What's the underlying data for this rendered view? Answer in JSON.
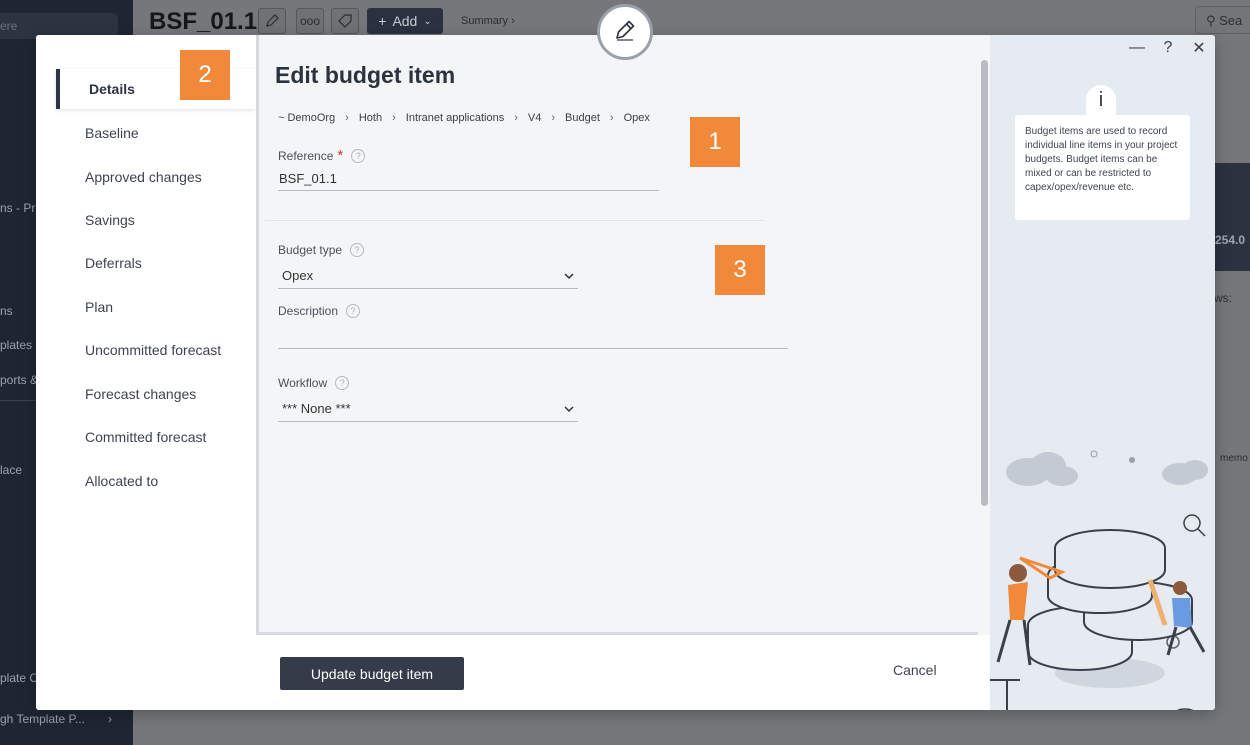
{
  "background": {
    "title": "BSF_01.1",
    "add_label": "Add",
    "summary_label": "Summary",
    "search_label": "Sea",
    "sidebar_search": "ere",
    "sidebar_items": [
      "ns - Pro",
      "ns",
      "plates",
      "ports &",
      "lace",
      "plate C",
      "gh Template P..."
    ],
    "value_label": "254.0",
    "rows_label": "ws:",
    "memo_label": "memo"
  },
  "modal": {
    "title": "Edit budget item",
    "breadcrumb": [
      "~ DemoOrg",
      "Hoth",
      "Intranet applications",
      "V4",
      "Budget",
      "Opex"
    ],
    "nav_items": [
      "Details",
      "Baseline",
      "Approved changes",
      "Savings",
      "Deferrals",
      "Plan",
      "Uncommitted forecast",
      "Forecast changes",
      "Committed forecast",
      "Allocated to"
    ],
    "fields": {
      "reference_label": "Reference",
      "reference_value": "BSF_01.1",
      "budget_type_label": "Budget type",
      "budget_type_value": "Opex",
      "description_label": "Description",
      "description_value": "",
      "workflow_label": "Workflow",
      "workflow_value": "*** None ***"
    },
    "buttons": {
      "update": "Update budget item",
      "cancel": "Cancel"
    },
    "info_text": "Budget items are used to record individual line items in your project budgets. Budget items can be mixed or can be restricted to capex/opex/revenue etc.",
    "info_icon_glyph": "i",
    "window_controls": {
      "minimize": "—",
      "help": "?",
      "close": "✕"
    }
  },
  "annotations": {
    "badge_1": "1",
    "badge_2": "2",
    "badge_3": "3"
  },
  "colors": {
    "accent_dark": "#343b49",
    "badge_orange": "#f0893a",
    "required_red": "#d9332c",
    "info_panel_bg": "#e6eaf1"
  }
}
